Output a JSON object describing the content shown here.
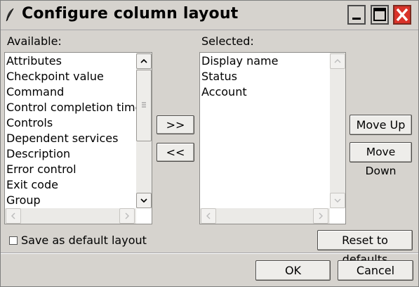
{
  "window": {
    "title": "Configure column layout"
  },
  "available": {
    "label": "Available:",
    "items": [
      "Attributes",
      "Checkpoint value",
      "Command",
      "Control completion time",
      "Controls",
      "Dependent services",
      "Description",
      "Error control",
      "Exit code",
      "Group"
    ]
  },
  "selected": {
    "label": "Selected:",
    "items": [
      "Display name",
      "Status",
      "Account"
    ]
  },
  "buttons": {
    "add": ">>",
    "remove": "<<",
    "move_up": "Move Up",
    "move_down": "Move Down",
    "reset": "Reset to defaults",
    "ok": "OK",
    "cancel": "Cancel"
  },
  "save_default": {
    "label": "Save as default layout",
    "checked": false
  },
  "icons": {
    "title": "feather-icon",
    "minimize": "minimize-icon",
    "maximize": "maximize-icon",
    "close": "close-icon"
  },
  "colors": {
    "window_bg": "#d6d3ce",
    "close_button": "#d9332a"
  }
}
